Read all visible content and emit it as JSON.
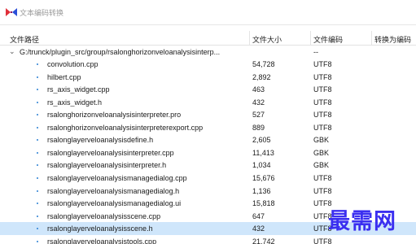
{
  "window": {
    "title": "文本编码转换",
    "icon": "bowtie-app-icon"
  },
  "columns": {
    "path": "文件路径",
    "size": "文件大小",
    "encoding": "文件编码",
    "convert_to": "转换为编码"
  },
  "tree": {
    "root": {
      "path": "G:/trunck/plugin_src/group/rsalonghorizonveloanalysisinterp...",
      "size": "",
      "encoding": "--",
      "convert_to": "",
      "expanded": true
    },
    "files": [
      {
        "name": "convolution.cpp",
        "size": "54,728",
        "encoding": "UTF8",
        "selected": false
      },
      {
        "name": "hilbert.cpp",
        "size": "2,892",
        "encoding": "UTF8",
        "selected": false
      },
      {
        "name": "rs_axis_widget.cpp",
        "size": "463",
        "encoding": "UTF8",
        "selected": false
      },
      {
        "name": "rs_axis_widget.h",
        "size": "432",
        "encoding": "UTF8",
        "selected": false
      },
      {
        "name": "rsalonghorizonveloanalysisinterpreter.pro",
        "size": "527",
        "encoding": "UTF8",
        "selected": false
      },
      {
        "name": "rsalonghorizonveloanalysisinterpreterexport.cpp",
        "size": "889",
        "encoding": "UTF8",
        "selected": false
      },
      {
        "name": "rsalonglayerveloanalysisdefine.h",
        "size": "2,605",
        "encoding": "GBK",
        "selected": false
      },
      {
        "name": "rsalonglayerveloanalysisinterpreter.cpp",
        "size": "11,413",
        "encoding": "GBK",
        "selected": false
      },
      {
        "name": "rsalonglayerveloanalysisinterpreter.h",
        "size": "1,034",
        "encoding": "GBK",
        "selected": false
      },
      {
        "name": "rsalonglayerveloanalysismanagedialog.cpp",
        "size": "15,676",
        "encoding": "UTF8",
        "selected": false
      },
      {
        "name": "rsalonglayerveloanalysismanagedialog.h",
        "size": "1,136",
        "encoding": "UTF8",
        "selected": false
      },
      {
        "name": "rsalonglayerveloanalysismanagedialog.ui",
        "size": "15,818",
        "encoding": "UTF8",
        "selected": false
      },
      {
        "name": "rsalonglayerveloanalysisscene.cpp",
        "size": "647",
        "encoding": "UTF8",
        "selected": false
      },
      {
        "name": "rsalonglayerveloanalysisscene.h",
        "size": "432",
        "encoding": "UTF8",
        "selected": true
      },
      {
        "name": "rsalonglayerveloanalysistools.cpp",
        "size": "21,742",
        "encoding": "UTF8",
        "selected": false
      }
    ]
  },
  "watermark": "最需网",
  "colors": {
    "selection": "#cfe6fb",
    "bullet": "#2a7fd4",
    "watermark": "#3b2ff0",
    "icon_red": "#e0303a",
    "icon_blue": "#2b4fd8"
  }
}
